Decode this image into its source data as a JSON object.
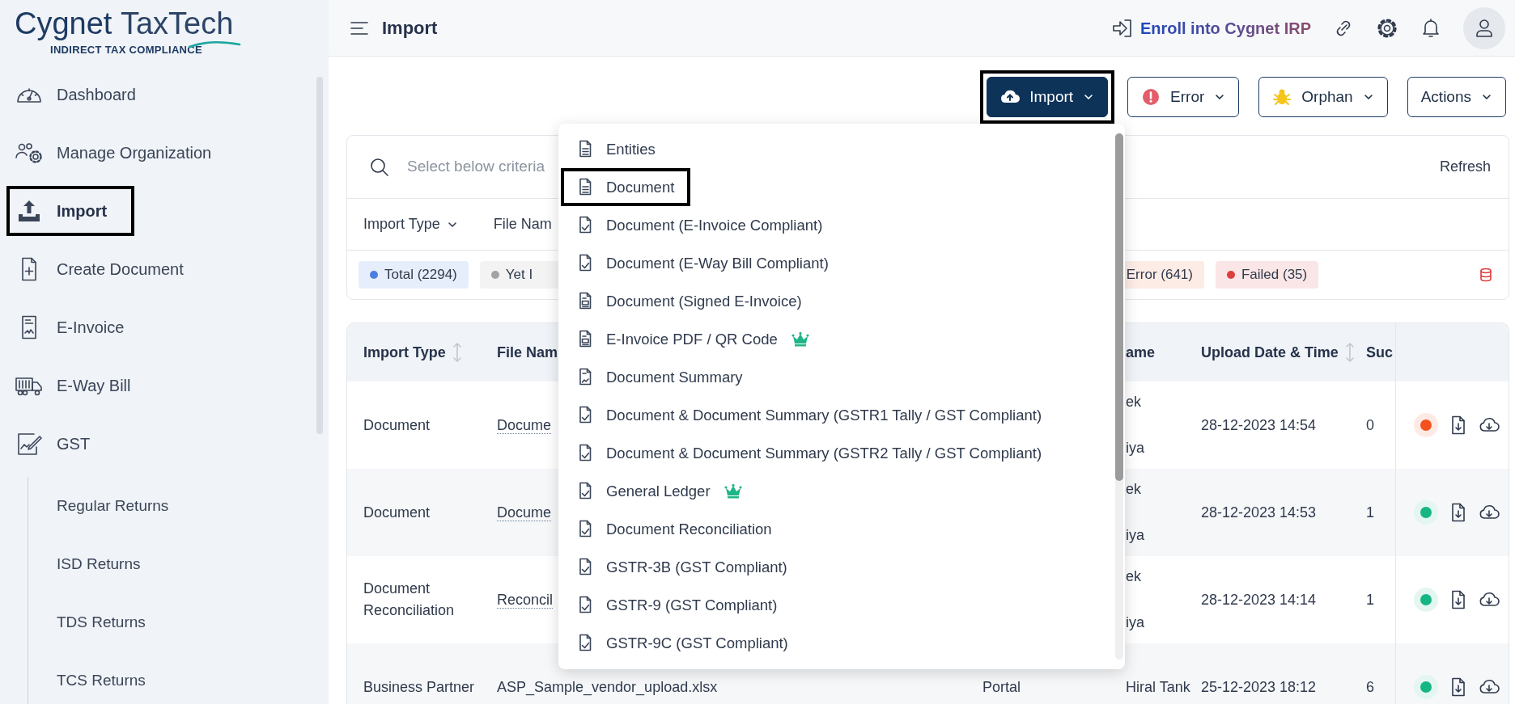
{
  "logo": {
    "name_bold": "Cygnet",
    "name_light": "TaxTech",
    "tagline": "INDIRECT TAX COMPLIANCE"
  },
  "sidebar": {
    "items": [
      {
        "label": "Dashboard",
        "selected": false,
        "highlighted": false
      },
      {
        "label": "Manage Organization",
        "selected": false,
        "highlighted": false
      },
      {
        "label": "Import",
        "selected": true,
        "highlighted": true
      },
      {
        "label": "Create Document",
        "selected": false,
        "highlighted": false
      },
      {
        "label": "E-Invoice",
        "selected": false,
        "highlighted": false
      },
      {
        "label": "E-Way Bill",
        "selected": false,
        "highlighted": false
      },
      {
        "label": "GST",
        "selected": false,
        "highlighted": false,
        "expanded": true,
        "children": [
          {
            "label": "Regular Returns",
            "selected": false
          },
          {
            "label": "ISD Returns",
            "selected": false
          },
          {
            "label": "TDS Returns",
            "selected": false
          },
          {
            "label": "TCS Returns",
            "selected": false
          }
        ]
      }
    ]
  },
  "header": {
    "title": "Import",
    "enroll": "Enroll into Cygnet IRP"
  },
  "toolbar": {
    "buttons": [
      {
        "label": "Import",
        "kind": "primary",
        "highlighted": true
      },
      {
        "label": "Error",
        "kind": "outline",
        "highlighted": false
      },
      {
        "label": "Orphan",
        "kind": "outline",
        "highlighted": false
      },
      {
        "label": "Actions",
        "kind": "outline",
        "highlighted": false
      }
    ]
  },
  "filters": {
    "search_placeholder": "Select below criteria",
    "refresh": "Refresh",
    "fields": [
      {
        "label": "Import Type",
        "dropdown": true
      },
      {
        "label": "File Nam",
        "dropdown": false
      }
    ],
    "chips": [
      {
        "label": "Total (2294)",
        "color": "#4a7fe0",
        "dot": true
      },
      {
        "label": "Yet I",
        "color": "#a3a3a3",
        "dot": true
      },
      {
        "label": "Error (641)",
        "color": "#fdece6",
        "dot": false
      },
      {
        "label": "Failed (35)",
        "color": "#dc3f3f",
        "dot": true
      }
    ]
  },
  "import_menu": {
    "expanded": true,
    "items": [
      {
        "label": "Entities",
        "kind": "document",
        "premium": false,
        "highlighted": false
      },
      {
        "label": "Document",
        "kind": "document",
        "premium": false,
        "highlighted": true
      },
      {
        "label": "Document (E-Invoice Compliant)",
        "kind": "compliant",
        "premium": false,
        "highlighted": false
      },
      {
        "label": "Document (E-Way Bill Compliant)",
        "kind": "compliant",
        "premium": false,
        "highlighted": false
      },
      {
        "label": "Document (Signed E-Invoice)",
        "kind": "signed",
        "premium": false,
        "highlighted": false
      },
      {
        "label": "E-Invoice PDF / QR Code",
        "kind": "signed",
        "premium": true,
        "highlighted": false
      },
      {
        "label": "Document Summary",
        "kind": "summary",
        "premium": false,
        "highlighted": false
      },
      {
        "label": "Document & Document Summary (GSTR1 Tally / GST Compliant)",
        "kind": "compliant",
        "premium": false,
        "highlighted": false
      },
      {
        "label": "Document & Document Summary (GSTR2 Tally / GST Compliant)",
        "kind": "compliant",
        "premium": false,
        "highlighted": false
      },
      {
        "label": "General Ledger",
        "kind": "compliant",
        "premium": true,
        "highlighted": false
      },
      {
        "label": "Document Reconciliation",
        "kind": "compliant",
        "premium": false,
        "highlighted": false
      },
      {
        "label": "GSTR-3B (GST Compliant)",
        "kind": "compliant",
        "premium": false,
        "highlighted": false
      },
      {
        "label": "GSTR-9 (GST Compliant)",
        "kind": "compliant",
        "premium": false,
        "highlighted": false
      },
      {
        "label": "GSTR-9C (GST Compliant)",
        "kind": "compliant",
        "premium": false,
        "highlighted": false
      }
    ]
  },
  "table": {
    "columns": [
      {
        "label": "Import Type",
        "sortable": true
      },
      {
        "label": "File Nam"
      },
      {},
      {
        "label": "ame"
      },
      {
        "label": "Upload Date & Time",
        "sortable": true
      },
      {
        "label": "Suc"
      },
      {}
    ],
    "rows": [
      {
        "import_type": "Document",
        "file_name": "Docume",
        "linked": true,
        "uploaded_by": [
          "ek",
          "iya"
        ],
        "uploaded_at": "28-12-2023 14:54",
        "success": "0",
        "color": "#f4511e"
      },
      {
        "import_type": "Document",
        "file_name": "Docume",
        "linked": true,
        "uploaded_by": [
          "ek",
          "iya"
        ],
        "uploaded_at": "28-12-2023 14:53",
        "success": "1",
        "color": "#16b584"
      },
      {
        "import_type": "Document Reconciliation",
        "file_name": "Reconcil",
        "linked": true,
        "uploaded_by": [
          "ek",
          "iya"
        ],
        "uploaded_at": "28-12-2023 14:14",
        "success": "1",
        "color": "#16b584"
      },
      {
        "import_type": "Business Partner",
        "file_name": "ASP_Sample_vendor_upload.xlsx",
        "linked": false,
        "source": "Portal",
        "uploaded_by": [
          "Hiral Tank"
        ],
        "uploaded_at": "25-12-2023 18:12",
        "success": "6",
        "color": "#16b584"
      }
    ]
  }
}
